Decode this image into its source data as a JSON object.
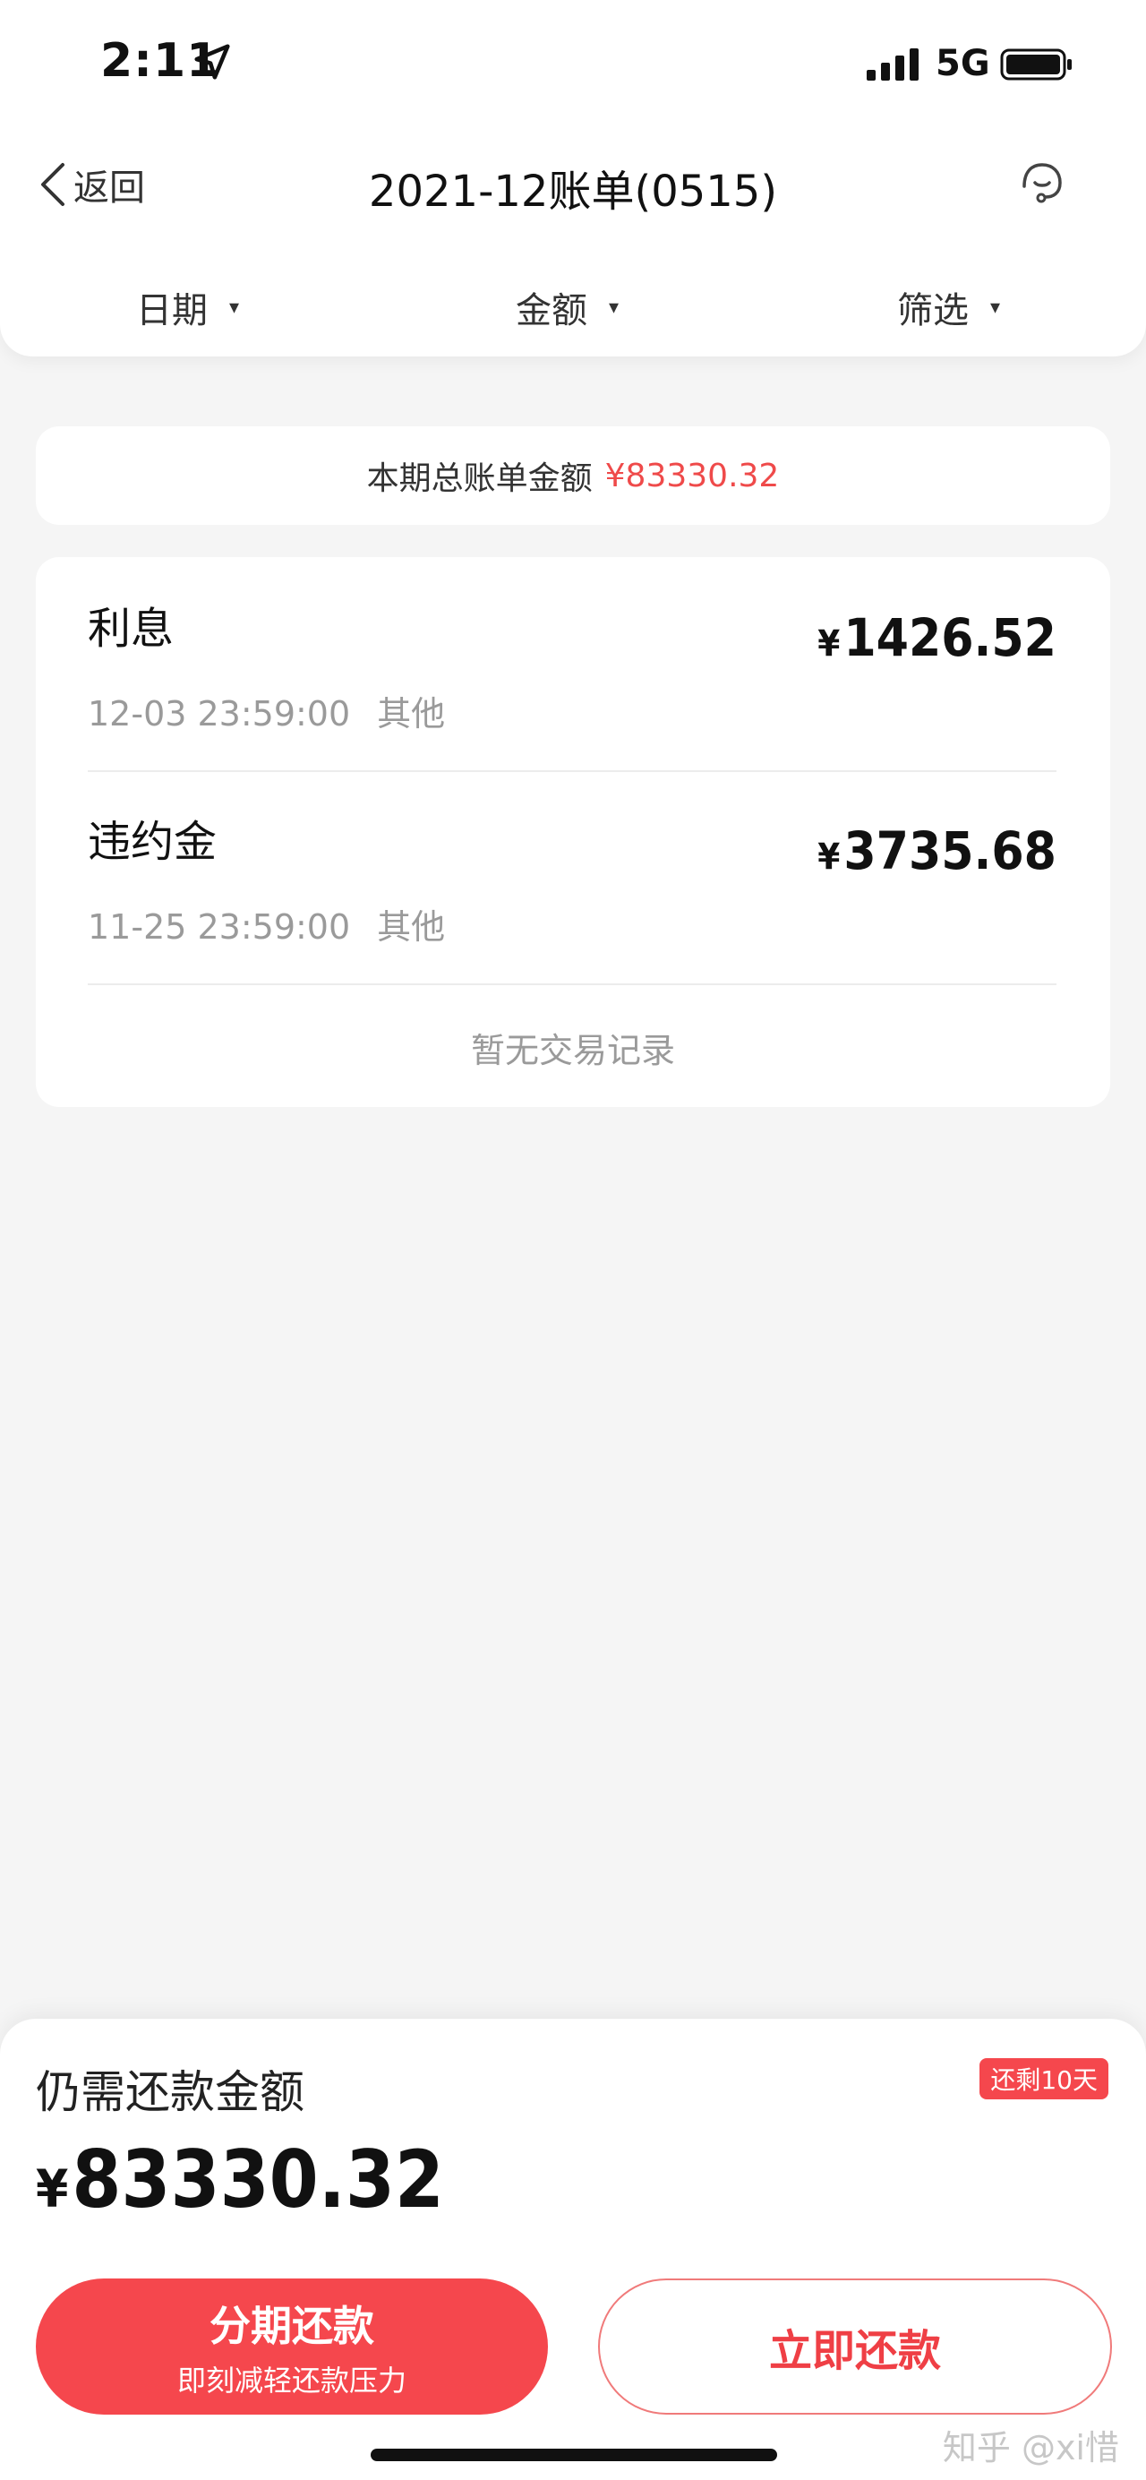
{
  "status_bar": {
    "time": "2:11",
    "network": "5G"
  },
  "header": {
    "back_label": "返回",
    "title": "2021-12账单(0515)"
  },
  "filters": [
    {
      "label": "日期",
      "caret": "▾"
    },
    {
      "label": "金额",
      "caret": "▾"
    },
    {
      "label": "筛选",
      "caret": "▾"
    }
  ],
  "summary": {
    "label": "本期总账单金额",
    "amount": "¥83330.32"
  },
  "transactions": [
    {
      "name": "利息",
      "currency": "¥",
      "amount": "1426.52",
      "datetime": "12-03 23:59:00",
      "category": "其他"
    },
    {
      "name": "违约金",
      "currency": "¥",
      "amount": "3735.68",
      "datetime": "11-25 23:59:00",
      "category": "其他"
    }
  ],
  "empty_text": "暂无交易记录",
  "bottom": {
    "due_label": "仍需还款金额",
    "days_left": "还剩10天",
    "currency": "¥",
    "due_amount": "83330.32",
    "installment_label": "分期还款",
    "installment_sub": "即刻减轻还款压力",
    "pay_now_label": "立即还款"
  },
  "watermark": "知乎 @xi惜",
  "colors": {
    "accent": "#f5474d",
    "amount_red": "#ef4a4a",
    "muted": "#9a9a9a"
  }
}
